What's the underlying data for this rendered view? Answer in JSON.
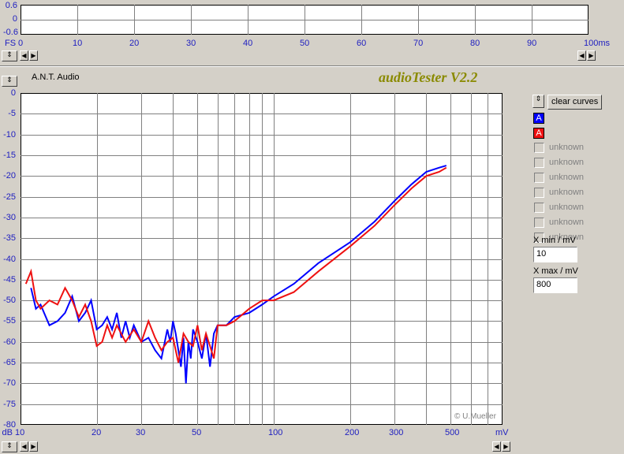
{
  "top_panel": {
    "y_ticks": [
      "0.6",
      "0",
      "-0.6"
    ],
    "x_unit_left": "FS",
    "x_ticks": [
      "0",
      "10",
      "20",
      "30",
      "40",
      "50",
      "60",
      "70",
      "80",
      "90",
      "100ms"
    ]
  },
  "header": {
    "vendor": "A.N.T. Audio",
    "app_title": "audioTester V2.2"
  },
  "main_plot": {
    "y_ticks": [
      "0",
      "-5",
      "-10",
      "-15",
      "-20",
      "-25",
      "-30",
      "-35",
      "-40",
      "-45",
      "-50",
      "-55",
      "-60",
      "-65",
      "-70",
      "-75",
      "-80"
    ],
    "y_unit": "dB",
    "x_ticks": [
      "10",
      "20",
      "30",
      "50",
      "100",
      "200",
      "300",
      "500"
    ],
    "x_unit": "mV",
    "copyright": "© U.Mueller"
  },
  "right_panel": {
    "clear_curves_label": "clear curves",
    "curve_letter_1": "A",
    "curve_letter_2": "A",
    "unknown_labels": [
      "unknown",
      "unknown",
      "unknown",
      "unknown",
      "unknown",
      "unknown",
      "unknown"
    ],
    "xmin_label": "X min / mV",
    "xmin_value": "10",
    "xmax_label": "X max / mV",
    "xmax_value": "800"
  },
  "colors": {
    "curve_blue": "#0000ff",
    "curve_red": "#ee1111",
    "title_olive": "#8a8a00",
    "tick_blue": "#2020c0"
  },
  "chart_data": {
    "type": "line",
    "xlabel": "mV",
    "ylabel": "dB",
    "x_scale": "log",
    "xlim": [
      10,
      800
    ],
    "ylim": [
      -80,
      0
    ],
    "grid": true,
    "series": [
      {
        "color": "#0000ff",
        "points": [
          [
            11,
            -47
          ],
          [
            11.5,
            -52
          ],
          [
            12,
            -51
          ],
          [
            13,
            -56
          ],
          [
            14,
            -55
          ],
          [
            15,
            -53
          ],
          [
            16,
            -49
          ],
          [
            17,
            -55
          ],
          [
            18,
            -53
          ],
          [
            19,
            -50
          ],
          [
            20,
            -57
          ],
          [
            21,
            -56
          ],
          [
            22,
            -54
          ],
          [
            23,
            -57
          ],
          [
            24,
            -53
          ],
          [
            25,
            -59
          ],
          [
            26,
            -55
          ],
          [
            27,
            -59
          ],
          [
            28,
            -56
          ],
          [
            30,
            -60
          ],
          [
            32,
            -59
          ],
          [
            34,
            -62
          ],
          [
            36,
            -64
          ],
          [
            38,
            -57
          ],
          [
            39,
            -60
          ],
          [
            40,
            -55
          ],
          [
            41,
            -58
          ],
          [
            42,
            -62
          ],
          [
            43,
            -66
          ],
          [
            44,
            -59
          ],
          [
            45,
            -70
          ],
          [
            46,
            -60
          ],
          [
            47,
            -64
          ],
          [
            48,
            -57
          ],
          [
            50,
            -60
          ],
          [
            52,
            -64
          ],
          [
            54,
            -58
          ],
          [
            56,
            -66
          ],
          [
            58,
            -58
          ],
          [
            60,
            -56
          ],
          [
            65,
            -56
          ],
          [
            70,
            -54
          ],
          [
            80,
            -53
          ],
          [
            90,
            -51
          ],
          [
            100,
            -49
          ],
          [
            120,
            -46
          ],
          [
            150,
            -41
          ],
          [
            200,
            -36
          ],
          [
            250,
            -31
          ],
          [
            300,
            -26
          ],
          [
            350,
            -22
          ],
          [
            400,
            -19
          ],
          [
            450,
            -18
          ],
          [
            480,
            -17.5
          ]
        ]
      },
      {
        "color": "#ee1111",
        "points": [
          [
            10.5,
            -46
          ],
          [
            11,
            -43
          ],
          [
            11.5,
            -50
          ],
          [
            12,
            -52
          ],
          [
            13,
            -50
          ],
          [
            14,
            -51
          ],
          [
            15,
            -47
          ],
          [
            16,
            -50
          ],
          [
            17,
            -54
          ],
          [
            18,
            -51
          ],
          [
            19,
            -55
          ],
          [
            20,
            -61
          ],
          [
            21,
            -60
          ],
          [
            22,
            -56
          ],
          [
            23,
            -59
          ],
          [
            24,
            -56
          ],
          [
            26,
            -60
          ],
          [
            28,
            -57
          ],
          [
            30,
            -60
          ],
          [
            32,
            -55
          ],
          [
            34,
            -59
          ],
          [
            36,
            -62
          ],
          [
            38,
            -60
          ],
          [
            40,
            -59
          ],
          [
            42,
            -65
          ],
          [
            44,
            -58
          ],
          [
            46,
            -60
          ],
          [
            48,
            -61
          ],
          [
            50,
            -56
          ],
          [
            52,
            -62
          ],
          [
            54,
            -58
          ],
          [
            56,
            -61
          ],
          [
            58,
            -64
          ],
          [
            60,
            -56
          ],
          [
            65,
            -56
          ],
          [
            70,
            -55
          ],
          [
            80,
            -52
          ],
          [
            90,
            -50
          ],
          [
            100,
            -50
          ],
          [
            120,
            -48
          ],
          [
            150,
            -43
          ],
          [
            200,
            -37
          ],
          [
            250,
            -32
          ],
          [
            300,
            -27
          ],
          [
            350,
            -23
          ],
          [
            400,
            -20
          ],
          [
            450,
            -19
          ],
          [
            480,
            -18
          ]
        ]
      }
    ]
  }
}
